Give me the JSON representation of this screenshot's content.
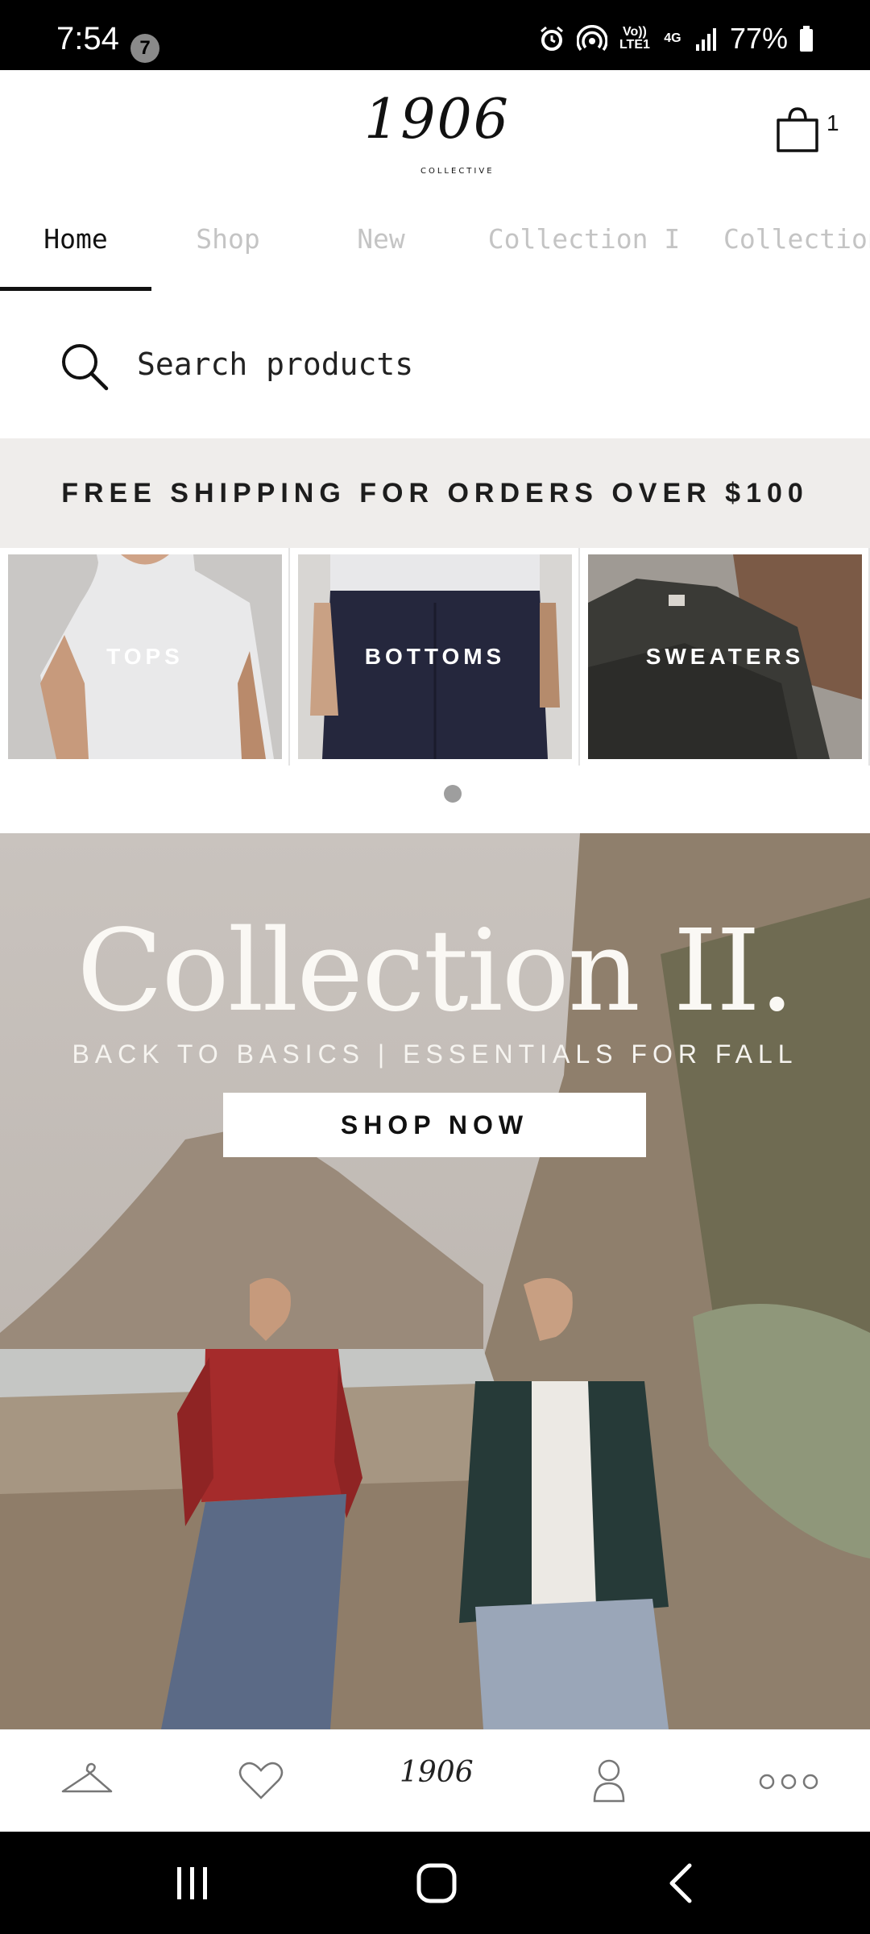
{
  "status_bar": {
    "time": "7:54",
    "notification_count": "7",
    "battery": "77%",
    "icons": [
      "alarm-icon",
      "hotspot-icon",
      "volte-icon",
      "4g-icon",
      "signal-icon",
      "battery-icon"
    ],
    "volte_label": "Vo)) LTE1",
    "net_label": "4G"
  },
  "header": {
    "logo_text": "1906",
    "logo_subtext": "COLLECTIVE",
    "cart_count": "1"
  },
  "tabs": [
    {
      "label": "Home",
      "active": true
    },
    {
      "label": "Shop",
      "active": false
    },
    {
      "label": "New",
      "active": false
    },
    {
      "label": "Collection I",
      "active": false
    },
    {
      "label": "Collection II",
      "active": false
    }
  ],
  "search": {
    "placeholder": "Search products"
  },
  "banner": {
    "text": "FREE SHIPPING FOR ORDERS OVER $100"
  },
  "categories": [
    {
      "label": "TOPS"
    },
    {
      "label": "BOTTOMS"
    },
    {
      "label": "SWEATERS"
    }
  ],
  "hero": {
    "title": "Collection II.",
    "subtitle": "BACK TO BASICS | ESSENTIALS FOR FALL",
    "cta": "SHOP NOW"
  },
  "bottom_nav": {
    "items": [
      "hanger-icon",
      "heart-icon",
      "home-logo",
      "account-icon",
      "more-icon"
    ],
    "logo_text": "1906"
  },
  "colors": {
    "accent": "#111111",
    "banner_bg": "#efedeb",
    "inactive_tab": "#c4c4c4"
  }
}
